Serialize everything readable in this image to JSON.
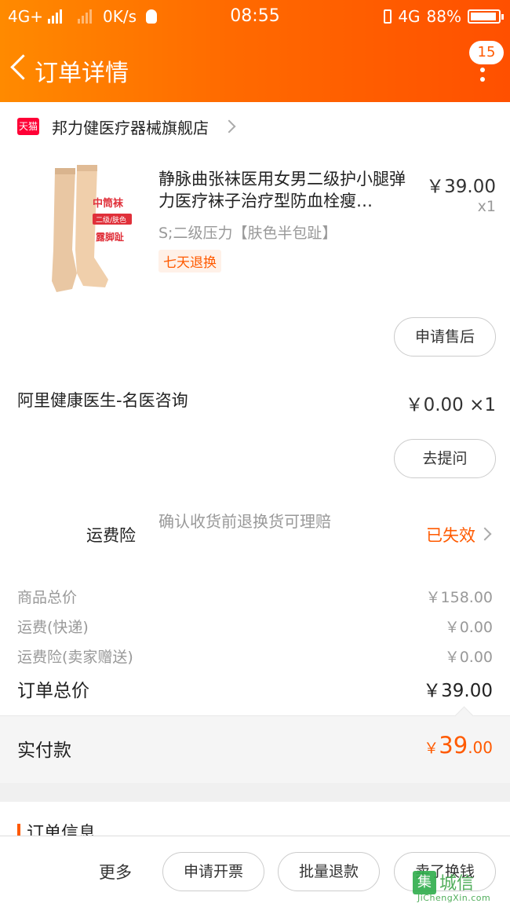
{
  "status_bar": {
    "network_left": "4G+",
    "speed": "0K/s",
    "time": "08:55",
    "network_right": "4G",
    "battery": "88%"
  },
  "nav": {
    "title": "订单详情",
    "badge_count": "15"
  },
  "shop": {
    "badge": "天猫",
    "name": "邦力健医疗器械旗舰店"
  },
  "product": {
    "title": "静脉曲张袜医用女男二级护小腿弹力医疗袜子治疗型防血栓瘦…",
    "price": "￥39.00",
    "qty": "x1",
    "sku": "S;二级压力【肤色半包趾】",
    "tag": "七天退换",
    "image_text": {
      "line1": "中筒袜",
      "line2": "二级/肤色",
      "line3": "露脚趾"
    },
    "after_sale_label": "申请售后"
  },
  "consult": {
    "name": "阿里健康医生-名医咨询",
    "price": "￥0.00 ×1",
    "ask_label": "去提问"
  },
  "insurance": {
    "label": "运费险",
    "desc": "确认收货前退换货可理赔",
    "status": "已失效"
  },
  "fees": {
    "goods_label": "商品总价",
    "goods_value": "￥158.00",
    "shipping_label": "运费(快递)",
    "shipping_value": "￥0.00",
    "insurance_label": "运费险(卖家赠送)",
    "insurance_value": "￥0.00",
    "total_label": "订单总价",
    "total_value": "￥39.00"
  },
  "paid": {
    "label": "实付款",
    "currency": "￥",
    "integer": "39",
    "decimal": ".00"
  },
  "order_info": {
    "title": "订单信息"
  },
  "bottom_bar": {
    "more": "更多",
    "invoice": "申请开票",
    "batch_refund": "批量退款",
    "sell_label": "卖了换钱"
  },
  "watermark": {
    "logo": "集",
    "name": "城信",
    "url": "JiChengXin.com"
  },
  "colors": {
    "accent": "#ff5a00",
    "header_start": "#ff8a00",
    "header_end": "#ff5000",
    "tmall": "#ff0036"
  }
}
